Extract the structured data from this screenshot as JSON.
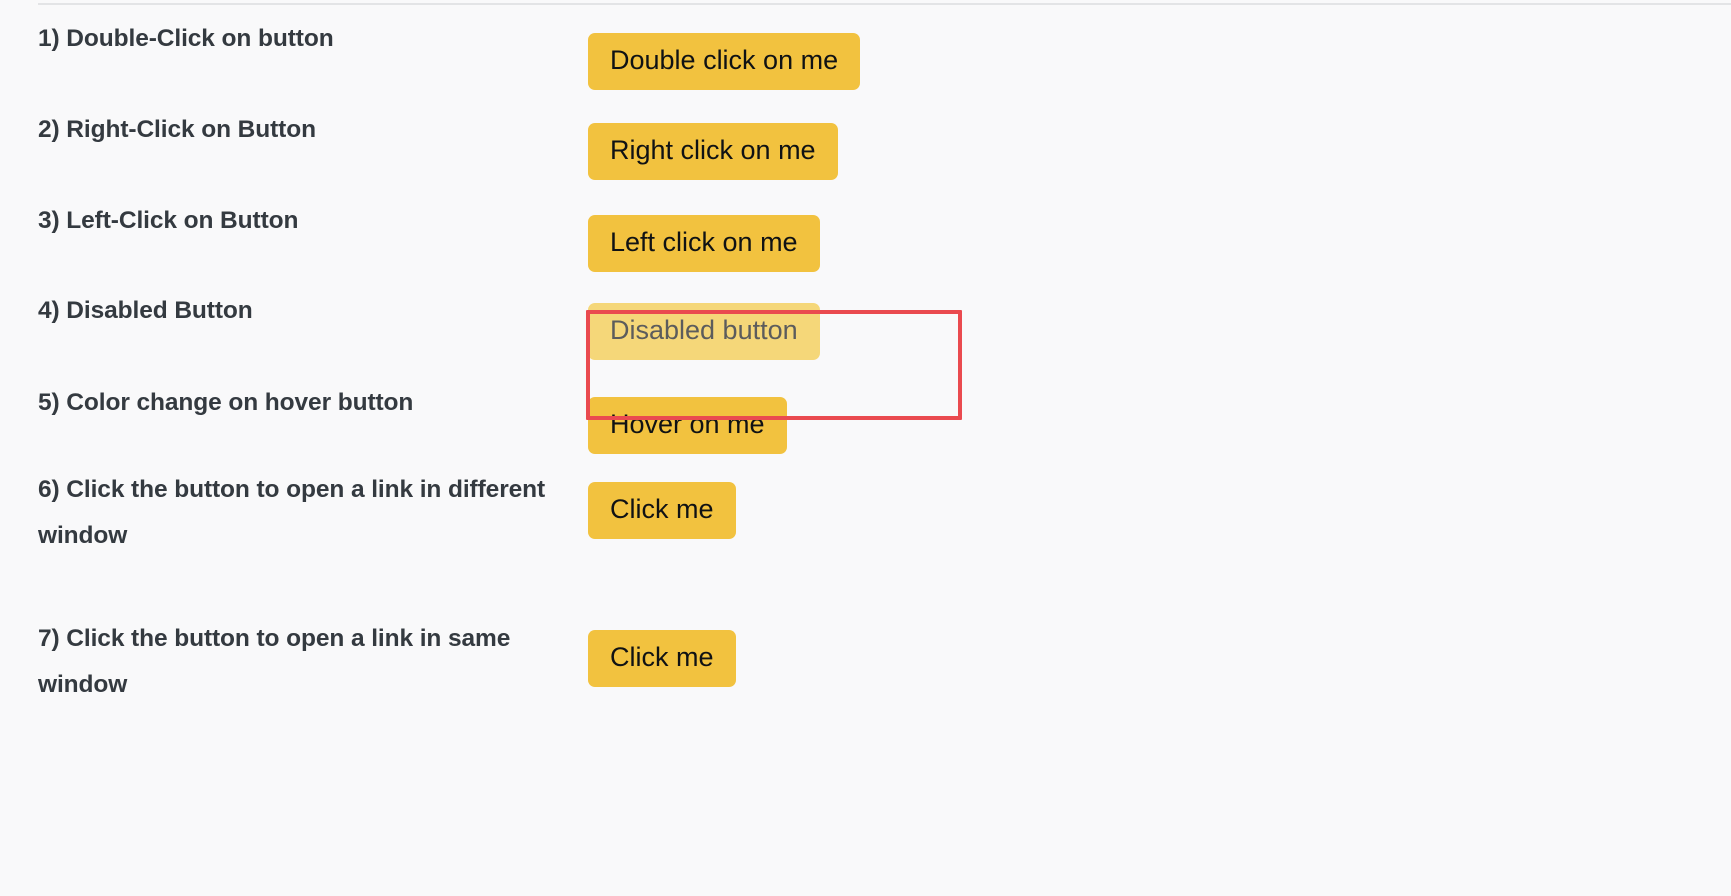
{
  "theme": {
    "page_background": "#f9f9fa",
    "button_color": "#f2c23f",
    "button_text_color": "#101214",
    "disabled_button_color": "#f5d779",
    "disabled_button_text_color": "#5c5c5c",
    "label_text_color": "#343a40",
    "annotation_color": "#ea4a4f",
    "divider_color": "#e3e4e6"
  },
  "items": [
    {
      "label": "1) Double-Click on button",
      "button_label": "Double click on me",
      "state": "enabled",
      "highlighted": false
    },
    {
      "label": "2) Right-Click on Button",
      "button_label": "Right click on me",
      "state": "enabled",
      "highlighted": false
    },
    {
      "label": "3) Left-Click on Button",
      "button_label": "Left click on me",
      "state": "enabled",
      "highlighted": false
    },
    {
      "label": "4) Disabled Button",
      "button_label": "Disabled button",
      "state": "disabled",
      "highlighted": true
    },
    {
      "label": "5) Color change on hover button",
      "button_label": "Hover on me",
      "state": "enabled",
      "highlighted": false
    },
    {
      "label": "6) Click the button to open a link in different window",
      "button_label": "Click me",
      "state": "enabled",
      "highlighted": false
    },
    {
      "label": "7) Click the button to open a link in same window",
      "button_label": "Click me",
      "state": "enabled",
      "highlighted": false
    }
  ]
}
